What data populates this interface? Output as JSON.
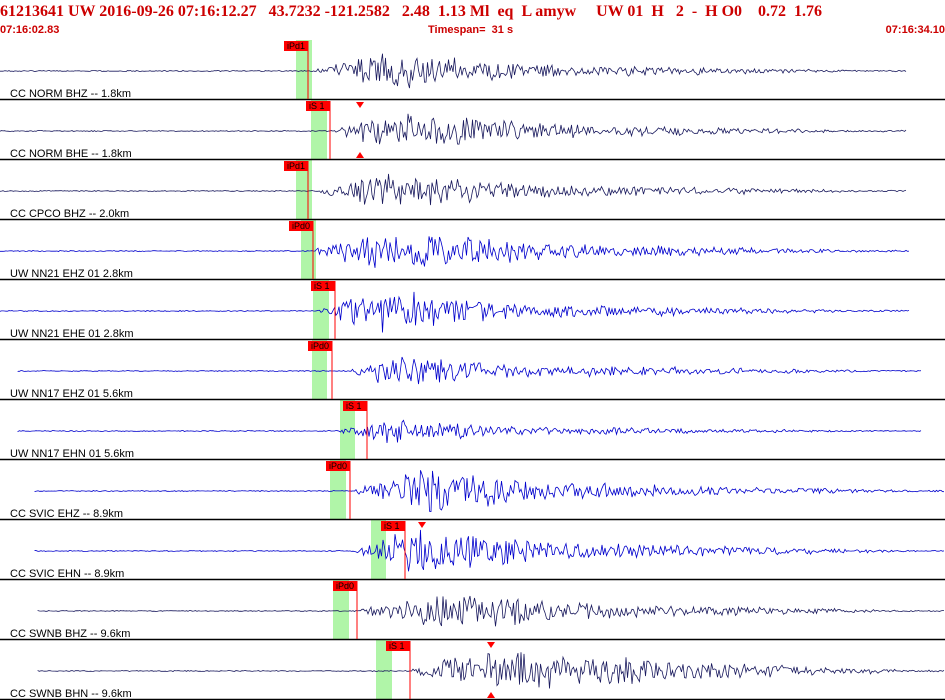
{
  "header": {
    "title": "61213641 UW 2016-09-26 07:16:12.27   43.7232 -121.2582   2.48  1.13 Ml  eq  L amyw     UW 01  H   2  -  H O0    0.72  1.76",
    "start_time": "07:16:02.83",
    "timespan": "Timespan=  31 s",
    "end_time": "07:16:34.10"
  },
  "colors": {
    "header_text": "#cc0000",
    "pick_box": "#ff0000",
    "window": "#b0f5a8",
    "trace_cc": "#1a1a5e",
    "trace_uw": "#0000cc",
    "separator": "#000000"
  },
  "channels": [
    {
      "label": "CC NORM BHZ -- 1.8km",
      "color": "cc",
      "pick": {
        "label": "iPd1"
      },
      "marker": "down"
    },
    {
      "label": "CC NORM BHE -- 1.8km",
      "color": "cc",
      "pick": {
        "label": "iS 1"
      },
      "marker": "both"
    },
    {
      "label": "CC CPCO BHZ -- 2.0km",
      "color": "cc",
      "pick": {
        "label": "iPd1"
      },
      "marker": ""
    },
    {
      "label": "UW NN21 EHZ 01 2.8km",
      "color": "uw",
      "pick": {
        "label": "iPd0"
      },
      "marker": ""
    },
    {
      "label": "UW NN21 EHE 01 2.8km",
      "color": "uw",
      "pick": {
        "label": "iS 1"
      },
      "marker": ""
    },
    {
      "label": "UW NN17 EHZ 01 5.6km",
      "color": "uw",
      "pick": {
        "label": "iPd0"
      },
      "marker": ""
    },
    {
      "label": "UW NN17 EHN 01 5.6km",
      "color": "uw",
      "pick": {
        "label": "iS 1"
      },
      "marker": ""
    },
    {
      "label": "CC SVIC EHZ -- 8.9km",
      "color": "uw",
      "pick": {
        "label": "iPd0"
      },
      "marker": ""
    },
    {
      "label": "CC SVIC EHN -- 8.9km",
      "color": "uw",
      "pick": {
        "label": "iS 1"
      },
      "marker": "down"
    },
    {
      "label": "CC SWNB BHZ -- 9.6km",
      "color": "cc",
      "pick": {
        "label": "iPd0"
      },
      "marker": ""
    },
    {
      "label": "CC SWNB BHN -- 9.6km",
      "color": "cc",
      "pick": {
        "label": "iS 1"
      },
      "marker": "both"
    }
  ]
}
